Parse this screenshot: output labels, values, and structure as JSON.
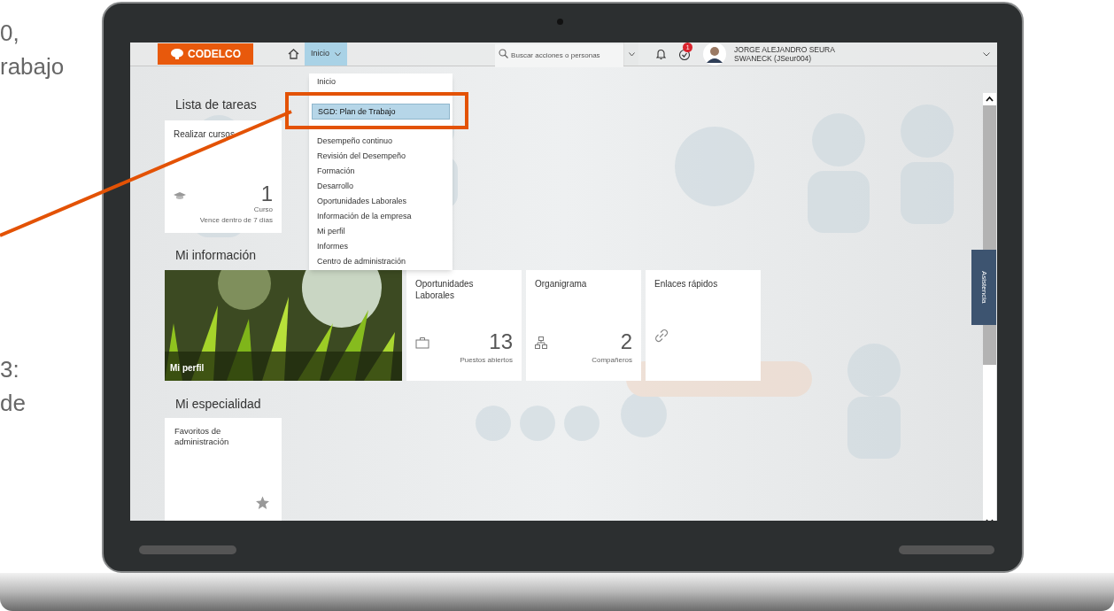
{
  "side_text": [
    [
      "0,",
      "rabajo"
    ],
    [
      "3:",
      "de"
    ]
  ],
  "header": {
    "logo": "CODELCO",
    "nav_button": "Inicio",
    "search": {
      "placeholder": "Buscar acciones o personas"
    },
    "task_badge": "1",
    "user": {
      "name": "JORGE ALEJANDRO SEURA",
      "id_line": "SWANECK (JSeur004)"
    }
  },
  "menu": {
    "items": [
      {
        "label": "Inicio",
        "selected": false
      },
      {
        "label": "SGD: Plan de Trabajo",
        "selected": true
      },
      {
        "label": "Desempeño continuo",
        "selected": false
      },
      {
        "label": "Revisión del Desempeño",
        "selected": false
      },
      {
        "label": "Formación",
        "selected": false
      },
      {
        "label": "Desarrollo",
        "selected": false
      },
      {
        "label": "Oportunidades Laborales",
        "selected": false
      },
      {
        "label": "Información de la empresa",
        "selected": false
      },
      {
        "label": "Mi perfil",
        "selected": false
      },
      {
        "label": "Informes",
        "selected": false
      },
      {
        "label": "Centro de administración",
        "selected": false
      }
    ]
  },
  "todo": {
    "title": "Lista de tareas",
    "card": {
      "title": "Realizar cursos",
      "count": "1",
      "unit": "Curso",
      "footer": "Vence dentro de 7 días"
    }
  },
  "info": {
    "title": "Mi información",
    "tiles": [
      {
        "kind": "picture",
        "label": "Mi perfil"
      },
      {
        "kind": "jobs",
        "title": "Oportunidades Laborales",
        "count": "13",
        "unit": "Puestos abiertos"
      },
      {
        "kind": "people",
        "title": "Organigrama",
        "count": "2",
        "unit": "Compañeros"
      },
      {
        "kind": "links",
        "title": "Enlaces rápidos"
      }
    ]
  },
  "specialty": {
    "title": "Mi especialidad",
    "card": {
      "title": "Favoritos de administración"
    }
  },
  "assist_tab": "Asistencia"
}
